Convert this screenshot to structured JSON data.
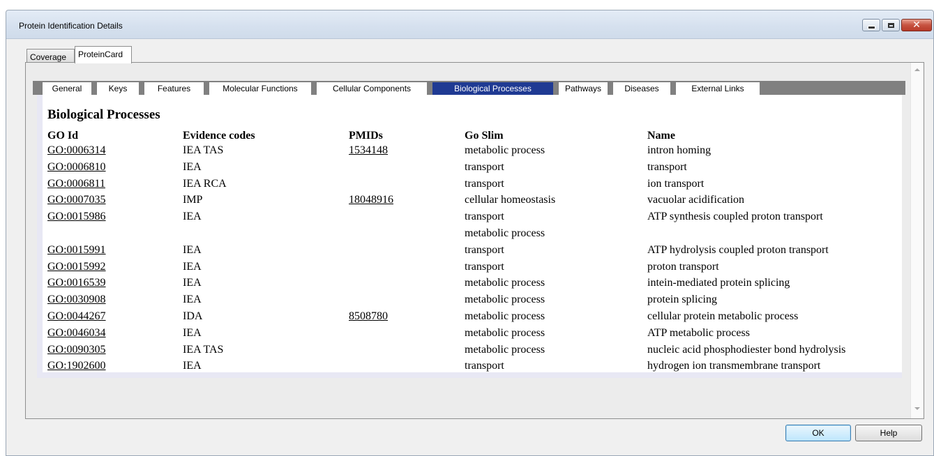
{
  "window": {
    "title": "Protein Identification Details"
  },
  "outer_tabs": [
    {
      "label": "Coverage",
      "active": false
    },
    {
      "label": "ProteinCard",
      "active": true
    }
  ],
  "inner_tabs": [
    {
      "label": "General",
      "active": false
    },
    {
      "label": "Keys",
      "active": false
    },
    {
      "label": "Features",
      "active": false
    },
    {
      "label": "Molecular Functions",
      "active": false
    },
    {
      "label": "Cellular Components",
      "active": false
    },
    {
      "label": "Biological Processes",
      "active": true
    },
    {
      "label": "Pathways",
      "active": false
    },
    {
      "label": "Diseases",
      "active": false
    },
    {
      "label": "External Links",
      "active": false
    }
  ],
  "section": {
    "title": "Biological Processes",
    "columns": [
      "GO Id",
      "Evidence codes",
      "PMIDs",
      "Go Slim",
      "Name"
    ],
    "rows": [
      {
        "go_id": "GO:0006314",
        "evidence": "IEA TAS",
        "pmid": "1534148",
        "slim": [
          "metabolic process"
        ],
        "name": "intron homing"
      },
      {
        "go_id": "GO:0006810",
        "evidence": "IEA",
        "pmid": "",
        "slim": [
          "transport"
        ],
        "name": "transport"
      },
      {
        "go_id": "GO:0006811",
        "evidence": "IEA RCA",
        "pmid": "",
        "slim": [
          "transport"
        ],
        "name": "ion transport"
      },
      {
        "go_id": "GO:0007035",
        "evidence": "IMP",
        "pmid": "18048916",
        "slim": [
          "cellular homeostasis"
        ],
        "name": "vacuolar acidification"
      },
      {
        "go_id": "GO:0015986",
        "evidence": "IEA",
        "pmid": "",
        "slim": [
          "transport",
          "metabolic process"
        ],
        "name": "ATP synthesis coupled proton transport"
      },
      {
        "go_id": "GO:0015991",
        "evidence": "IEA",
        "pmid": "",
        "slim": [
          "transport"
        ],
        "name": "ATP hydrolysis coupled proton transport"
      },
      {
        "go_id": "GO:0015992",
        "evidence": "IEA",
        "pmid": "",
        "slim": [
          "transport"
        ],
        "name": "proton transport"
      },
      {
        "go_id": "GO:0016539",
        "evidence": "IEA",
        "pmid": "",
        "slim": [
          "metabolic process"
        ],
        "name": "intein-mediated protein splicing"
      },
      {
        "go_id": "GO:0030908",
        "evidence": "IEA",
        "pmid": "",
        "slim": [
          "metabolic process"
        ],
        "name": "protein splicing"
      },
      {
        "go_id": "GO:0044267",
        "evidence": "IDA",
        "pmid": "8508780",
        "slim": [
          "metabolic process"
        ],
        "name": "cellular protein metabolic process"
      },
      {
        "go_id": "GO:0046034",
        "evidence": "IEA",
        "pmid": "",
        "slim": [
          "metabolic process"
        ],
        "name": "ATP metabolic process"
      },
      {
        "go_id": "GO:0090305",
        "evidence": "IEA TAS",
        "pmid": "",
        "slim": [
          "metabolic process"
        ],
        "name": "nucleic acid phosphodiester bond hydrolysis"
      },
      {
        "go_id": "GO:1902600",
        "evidence": "IEA",
        "pmid": "",
        "slim": [
          "transport"
        ],
        "name": "hydrogen ion transmembrane transport"
      }
    ]
  },
  "buttons": {
    "ok": "OK",
    "help": "Help"
  },
  "colors": {
    "active_tab": "#1f3a93",
    "tabstrip": "#808080",
    "content_border": "#e8e8f4"
  }
}
